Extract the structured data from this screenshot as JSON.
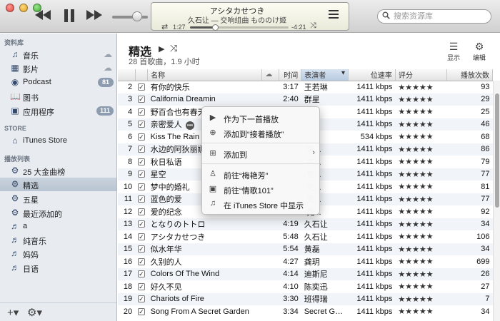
{
  "window": {
    "title": "iTunes"
  },
  "player": {
    "song": "アシタカせつき",
    "artist_line": "久石让 — 交响组曲 もののけ姬",
    "elapsed": "1:27",
    "remaining": "-4:21",
    "progress": 0.25
  },
  "search": {
    "placeholder": "搜索资源库"
  },
  "sidebar": {
    "library_header": "资料库",
    "library": [
      {
        "label": "音乐",
        "icon": "music-note-icon",
        "cloud": true
      },
      {
        "label": "影片",
        "icon": "film-icon",
        "cloud": true
      },
      {
        "label": "Podcast",
        "icon": "podcast-icon",
        "badge": "81"
      },
      {
        "label": "图书",
        "icon": "book-icon"
      },
      {
        "label": "应用程序",
        "icon": "apps-icon",
        "badge": "111"
      }
    ],
    "store_header": "STORE",
    "store": [
      {
        "label": "iTunes Store",
        "icon": "store-icon"
      }
    ],
    "playlists_header": "播放列表",
    "playlists": [
      {
        "label": "25 大金曲榜",
        "icon": "gear-icon"
      },
      {
        "label": "精选",
        "icon": "gear-icon",
        "selected": true
      },
      {
        "label": "五星",
        "icon": "gear-icon"
      },
      {
        "label": "最近添加的",
        "icon": "gear-icon"
      },
      {
        "label": "a",
        "icon": "playlist-icon"
      },
      {
        "label": "纯音乐",
        "icon": "playlist-icon"
      },
      {
        "label": "妈妈",
        "icon": "playlist-icon"
      },
      {
        "label": "日语",
        "icon": "playlist-icon"
      }
    ]
  },
  "main": {
    "title": "精选",
    "subtitle": "28 首歌曲，1.9 小时",
    "view_label": "显示",
    "edit_label": "编辑",
    "columns": {
      "name": "名称",
      "time": "时间",
      "artist": "表演者",
      "bitrate": "位速率",
      "rating": "评分",
      "plays": "播放次数"
    },
    "rows": [
      {
        "n": "2",
        "name": "有你的快乐",
        "time": "3:17",
        "artist": "王若琳",
        "bitrate": "1411 kbps",
        "rating": "★★★★★",
        "plays": "93"
      },
      {
        "n": "3",
        "name": "California Dreamin",
        "time": "2:40",
        "artist": "群星",
        "bitrate": "1411 kbps",
        "rating": "★★★★★",
        "plays": "29"
      },
      {
        "n": "4",
        "name": "野百合也有春天",
        "time": "",
        "artist": "",
        "bitrate": "1411 kbps",
        "rating": "★★★★★",
        "plays": "25"
      },
      {
        "n": "5",
        "name": "亲密爱人",
        "time": "",
        "artist": "",
        "bitrate": "1411 kbps",
        "rating": "★★★★★",
        "plays": "46"
      },
      {
        "n": "6",
        "name": "Kiss The Rain",
        "time": "",
        "artist": "",
        "bitrate": "534 kbps",
        "rating": "★★★★★",
        "plays": "68"
      },
      {
        "n": "7",
        "name": "水边的阿狄丽娜",
        "time": "",
        "artist": "·克...",
        "bitrate": "1411 kbps",
        "rating": "★★★★★",
        "plays": "86"
      },
      {
        "n": "8",
        "name": "秋日私语",
        "time": "",
        "artist": "·克...",
        "bitrate": "1411 kbps",
        "rating": "★★★★★",
        "plays": "79"
      },
      {
        "n": "9",
        "name": "星空",
        "time": "",
        "artist": "·克...",
        "bitrate": "1411 kbps",
        "rating": "★★★★★",
        "plays": "77"
      },
      {
        "n": "10",
        "name": "梦中的婚礼",
        "time": "",
        "artist": "·克...",
        "bitrate": "1411 kbps",
        "rating": "★★★★★",
        "plays": "81"
      },
      {
        "n": "11",
        "name": "蓝色的爱",
        "time": "",
        "artist": "·克...",
        "bitrate": "1411 kbps",
        "rating": "★★★★★",
        "plays": "77"
      },
      {
        "n": "12",
        "name": "爱的纪念",
        "time": "",
        "artist": "·克...",
        "bitrate": "1411 kbps",
        "rating": "★★★★★",
        "plays": "92"
      },
      {
        "n": "13",
        "name": "となりのトトロ",
        "time": "4:19",
        "artist": "久石让",
        "bitrate": "1411 kbps",
        "rating": "★★★★★",
        "plays": "34"
      },
      {
        "n": "14",
        "name": "アシタカせつき",
        "time": "5:48",
        "artist": "久石让",
        "bitrate": "1411 kbps",
        "rating": "★★★★★",
        "plays": "106"
      },
      {
        "n": "15",
        "name": "似水年华",
        "time": "5:54",
        "artist": "黄磊",
        "bitrate": "1411 kbps",
        "rating": "★★★★★",
        "plays": "34"
      },
      {
        "n": "16",
        "name": "久别的人",
        "time": "4:27",
        "artist": "龚玥",
        "bitrate": "1411 kbps",
        "rating": "★★★★★",
        "plays": "699"
      },
      {
        "n": "17",
        "name": "Colors Of The Wind",
        "time": "4:14",
        "artist": "迪斯尼",
        "bitrate": "1411 kbps",
        "rating": "★★★★★",
        "plays": "26"
      },
      {
        "n": "18",
        "name": "好久不见",
        "time": "4:10",
        "artist": "陈奕迅",
        "bitrate": "1411 kbps",
        "rating": "★★★★★",
        "plays": "27"
      },
      {
        "n": "19",
        "name": "Chariots of Fire",
        "time": "3:30",
        "artist": "班得瑞",
        "bitrate": "1411 kbps",
        "rating": "★★★★★",
        "plays": "7"
      },
      {
        "n": "20",
        "name": "Song From A Secret Garden",
        "time": "3:34",
        "artist": "Secret Garden",
        "bitrate": "1411 kbps",
        "rating": "★★★★★",
        "plays": "34"
      }
    ]
  },
  "context_menu": {
    "items": [
      {
        "label": "作为下一首播放",
        "icon": "play-next-icon"
      },
      {
        "label": "添加到“接着播放”",
        "icon": "add-up-next-icon"
      },
      {
        "label": "添加到",
        "icon": "add-to-icon",
        "submenu": true
      },
      {
        "label": "前往“梅艳芳”",
        "icon": "artist-icon"
      },
      {
        "label": "前往“情歌101”",
        "icon": "album-icon"
      },
      {
        "label": "在 iTunes Store 中显示",
        "icon": "itunes-store-icon"
      }
    ]
  }
}
